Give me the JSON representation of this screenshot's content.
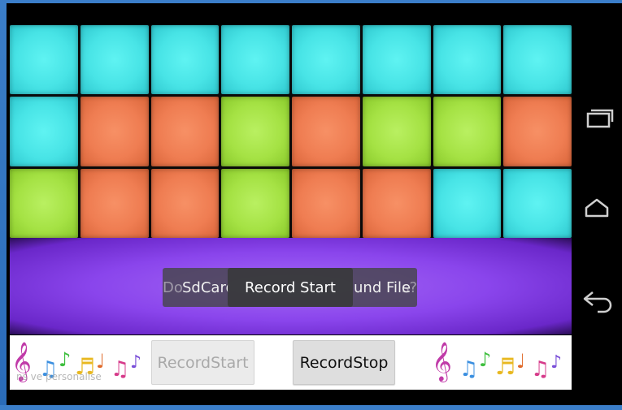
{
  "grid": {
    "rows": [
      [
        "cyan",
        "cyan",
        "cyan",
        "cyan",
        "cyan",
        "cyan",
        "cyan",
        "cyan"
      ],
      [
        "cyan",
        "orange",
        "orange",
        "green",
        "orange",
        "green",
        "green",
        "orange"
      ],
      [
        "green",
        "orange",
        "orange",
        "green",
        "orange",
        "orange",
        "cyan",
        "cyan"
      ]
    ]
  },
  "toasts": {
    "behind_left": "Do",
    "behind_right": "s?",
    "sdcard": "SdCard i",
    "record_start": "Record Start",
    "sound_file": "ound File"
  },
  "controls": {
    "record_start_label": "RecordStart",
    "record_stop_label": "RecordStop",
    "record_start_enabled": false,
    "record_stop_enabled": true
  },
  "watermark": "ns ve personalise",
  "navbar": {
    "recents_icon": "recents-icon",
    "home_icon": "home-icon",
    "back_icon": "back-icon"
  },
  "colors": {
    "cyan": "#48e4e6",
    "orange": "#ef7d52",
    "green": "#a5e244",
    "purple": "#8a45ec",
    "frame": "#3b7ec9"
  }
}
